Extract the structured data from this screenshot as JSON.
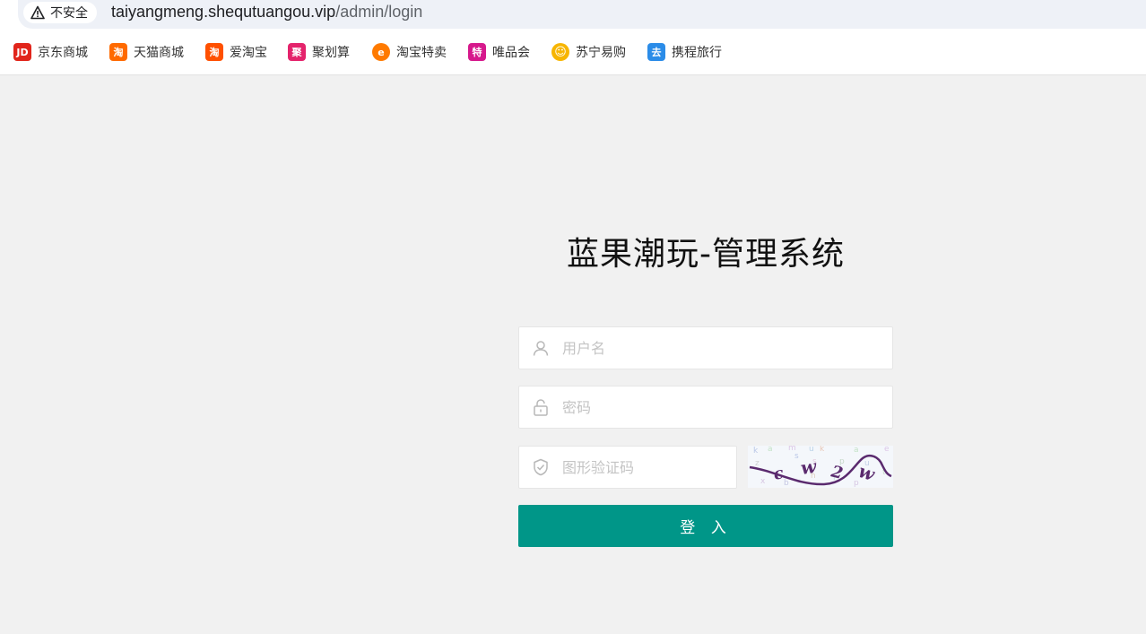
{
  "browser": {
    "security_label": "不安全",
    "url_host": "taiyangmeng.shequtuangou.vip",
    "url_path": "/admin/login"
  },
  "bookmarks": [
    {
      "label": "京东商城",
      "icon": "JD",
      "color": "#e1251b"
    },
    {
      "label": "天猫商城",
      "icon": "淘",
      "color": "#ff6a00"
    },
    {
      "label": "爱淘宝",
      "icon": "淘",
      "color": "#ff5000"
    },
    {
      "label": "聚划算",
      "icon": "聚",
      "color": "#e4236b"
    },
    {
      "label": "淘宝特卖",
      "icon": "e",
      "color": "#ff7a00"
    },
    {
      "label": "唯品会",
      "icon": "特",
      "color": "#d6198c"
    },
    {
      "label": "苏宁易购",
      "icon": "☺",
      "color": "#f7b500"
    },
    {
      "label": "携程旅行",
      "icon": "去",
      "color": "#2b8ce8"
    }
  ],
  "login": {
    "title": "蓝果潮玩-管理系统",
    "username_placeholder": "用户名",
    "password_placeholder": "密码",
    "captcha_placeholder": "图形验证码",
    "submit_label": "登 入",
    "captcha_text": "c w 2 w"
  },
  "colors": {
    "accent": "#009688",
    "background": "#f1f1f1"
  }
}
